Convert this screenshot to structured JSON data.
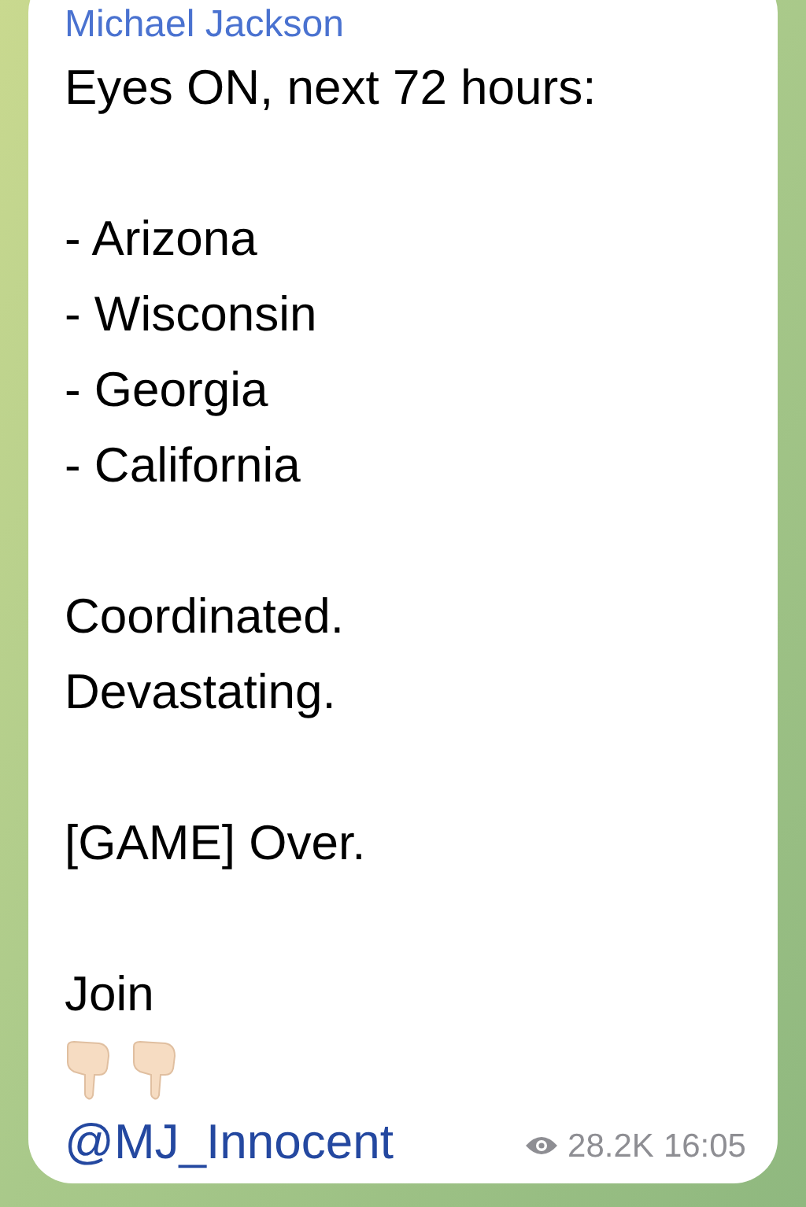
{
  "message": {
    "sender": "Michael Jackson",
    "paragraphs": [
      [
        "Eyes ON, next 72 hours:"
      ],
      [
        "- Arizona",
        "- Wisconsin",
        "- Georgia",
        "- California"
      ],
      [
        "Coordinated.",
        "Devastating."
      ],
      [
        "[GAME] Over."
      ],
      [
        "Join"
      ]
    ],
    "link": "@MJ_Innocent",
    "views": "28.2K",
    "time": "16:05"
  }
}
